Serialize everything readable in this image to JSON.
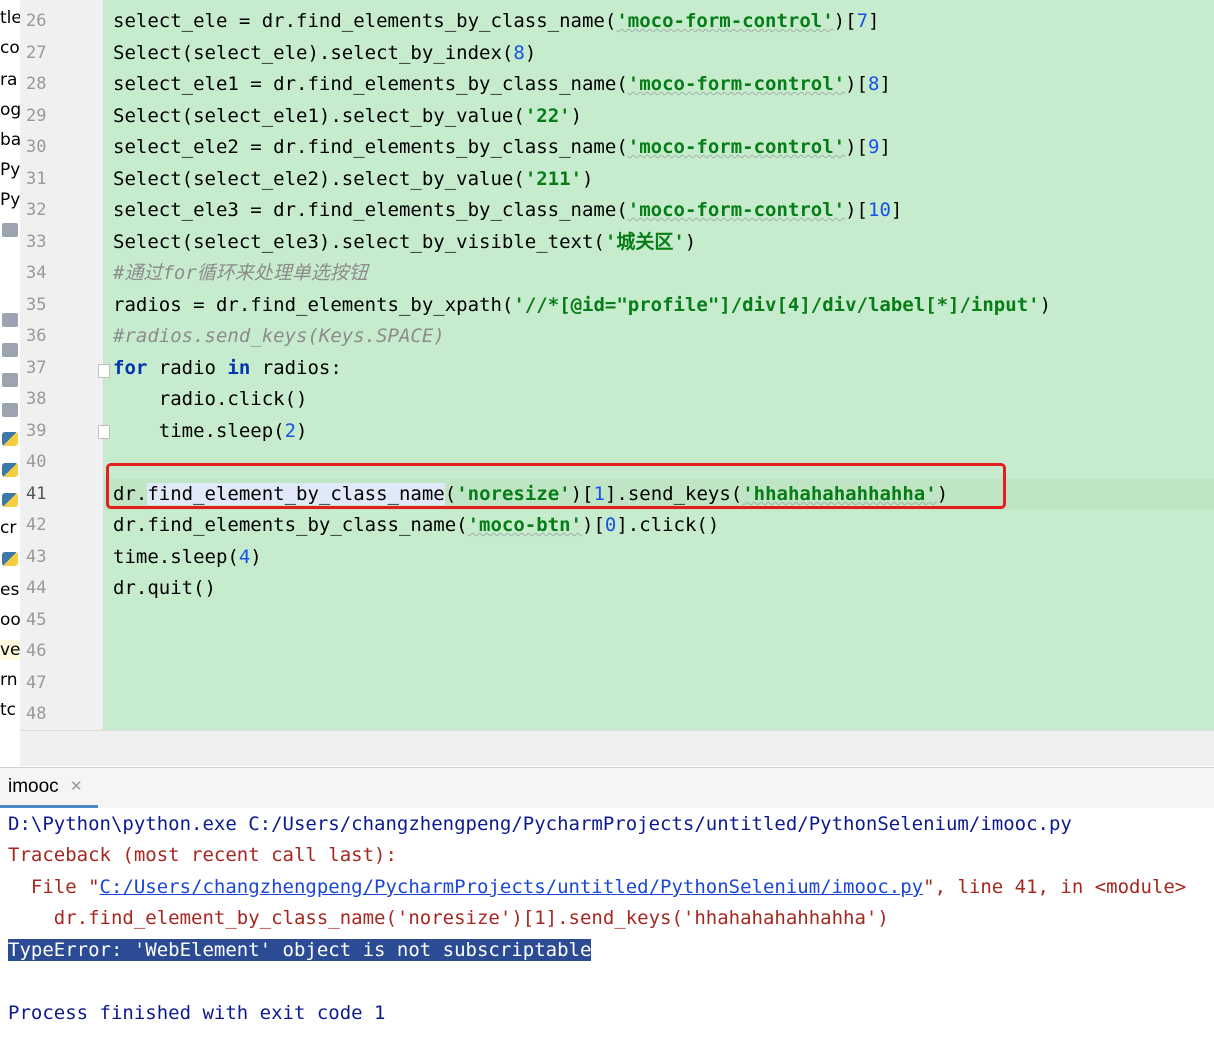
{
  "sidebar_fragments": [
    "tle",
    "co",
    "ra",
    "og",
    "ba",
    "Py",
    "Py",
    "cr",
    "es",
    "oo",
    "ve",
    "rn",
    "tc"
  ],
  "editor": {
    "current_line": 41,
    "line_numbers": [
      "26",
      "27",
      "28",
      "29",
      "30",
      "31",
      "32",
      "33",
      "34",
      "35",
      "36",
      "37",
      "38",
      "39",
      "40",
      "41",
      "42",
      "43",
      "44",
      "45",
      "46",
      "47",
      "48"
    ],
    "code": {
      "l26": {
        "a": "select_ele = dr.find_elements_by_class_name(",
        "s": "'moco-form-control'",
        "b": ")[",
        "n": "7",
        "c": "]"
      },
      "l27": {
        "a": "Select(select_ele).select_by_index(",
        "n": "8",
        "c": ")"
      },
      "l28": {
        "a": "select_ele1 = dr.find_elements_by_class_name(",
        "s": "'moco-form-control'",
        "b": ")[",
        "n": "8",
        "c": "]"
      },
      "l29": {
        "a": "Select(select_ele1).select_by_value(",
        "s": "'22'",
        "c": ")"
      },
      "l30": {
        "a": "select_ele2 = dr.find_elements_by_class_name(",
        "s": "'moco-form-control'",
        "b": ")[",
        "n": "9",
        "c": "]"
      },
      "l31": {
        "a": "Select(select_ele2).select_by_value(",
        "s": "'211'",
        "c": ")"
      },
      "l32": {
        "a": "select_ele3 = dr.find_elements_by_class_name(",
        "s": "'moco-form-control'",
        "b": ")[",
        "n": "10",
        "c": "]"
      },
      "l33": {
        "a": "Select(select_ele3).select_by_visible_text(",
        "s": "'城关区'",
        "c": ")"
      },
      "l34": {
        "cmt": "#通过for循环来处理单选按钮"
      },
      "l35": {
        "a": "radios = dr.find_elements_by_xpath(",
        "s": "'//*[@id=\"profile\"]/div[4]/div/label[*]/input'",
        "c": ")"
      },
      "l36": {
        "cmt": "#radios.send_keys(Keys.SPACE)"
      },
      "l37": {
        "kw1": "for",
        "a": " radio ",
        "kw2": "in",
        "c": " radios:"
      },
      "l38": {
        "a": "    radio.click()"
      },
      "l39": {
        "a": "    time.sleep(",
        "n": "2",
        "c": ")"
      },
      "l41": {
        "a": "dr.",
        "fn": "find_element_by_class_name",
        "b": "(",
        "s": "'noresize'",
        "b2": ")[",
        "n": "1",
        "c": "].send_keys(",
        "s2": "'hhahahahahhahha'",
        "c2": ")"
      },
      "l42": {
        "a": "dr.find_elements_by_class_name(",
        "s": "'moco-btn'",
        "b": ")[",
        "n": "0",
        "c": "].click()"
      },
      "l43": {
        "a": "time.sleep(",
        "n": "4",
        "c": ")"
      },
      "l44": {
        "a": "dr.quit()"
      }
    }
  },
  "run_panel": {
    "tab_label": "imooc",
    "tab_close": "✕",
    "output": {
      "cmd": "D:\\Python\\python.exe C:/Users/changzhengpeng/PycharmProjects/untitled/PythonSelenium/imooc.py",
      "traceback": "Traceback (most recent call last):",
      "file_prefix": "  File \"",
      "file_link": "C:/Users/changzhengpeng/PycharmProjects/untitled/PythonSelenium/imooc.py",
      "file_suffix": "\", line 41, in <module>",
      "err_code": "    dr.find_element_by_class_name('noresize')[1].send_keys('hhahahahahhahha')",
      "error": "TypeError: 'WebElement' object is not subscriptable",
      "finished": "Process finished with exit code 1"
    }
  },
  "colors": {
    "code_bg": "#c7eccd",
    "string": "#067d17",
    "number": "#1750eb",
    "keyword": "#0033b3",
    "comment": "#8c8c8c",
    "error_text": "#a6271f",
    "highlight_box": "#e41d1d",
    "selection": "#2b4c94"
  }
}
